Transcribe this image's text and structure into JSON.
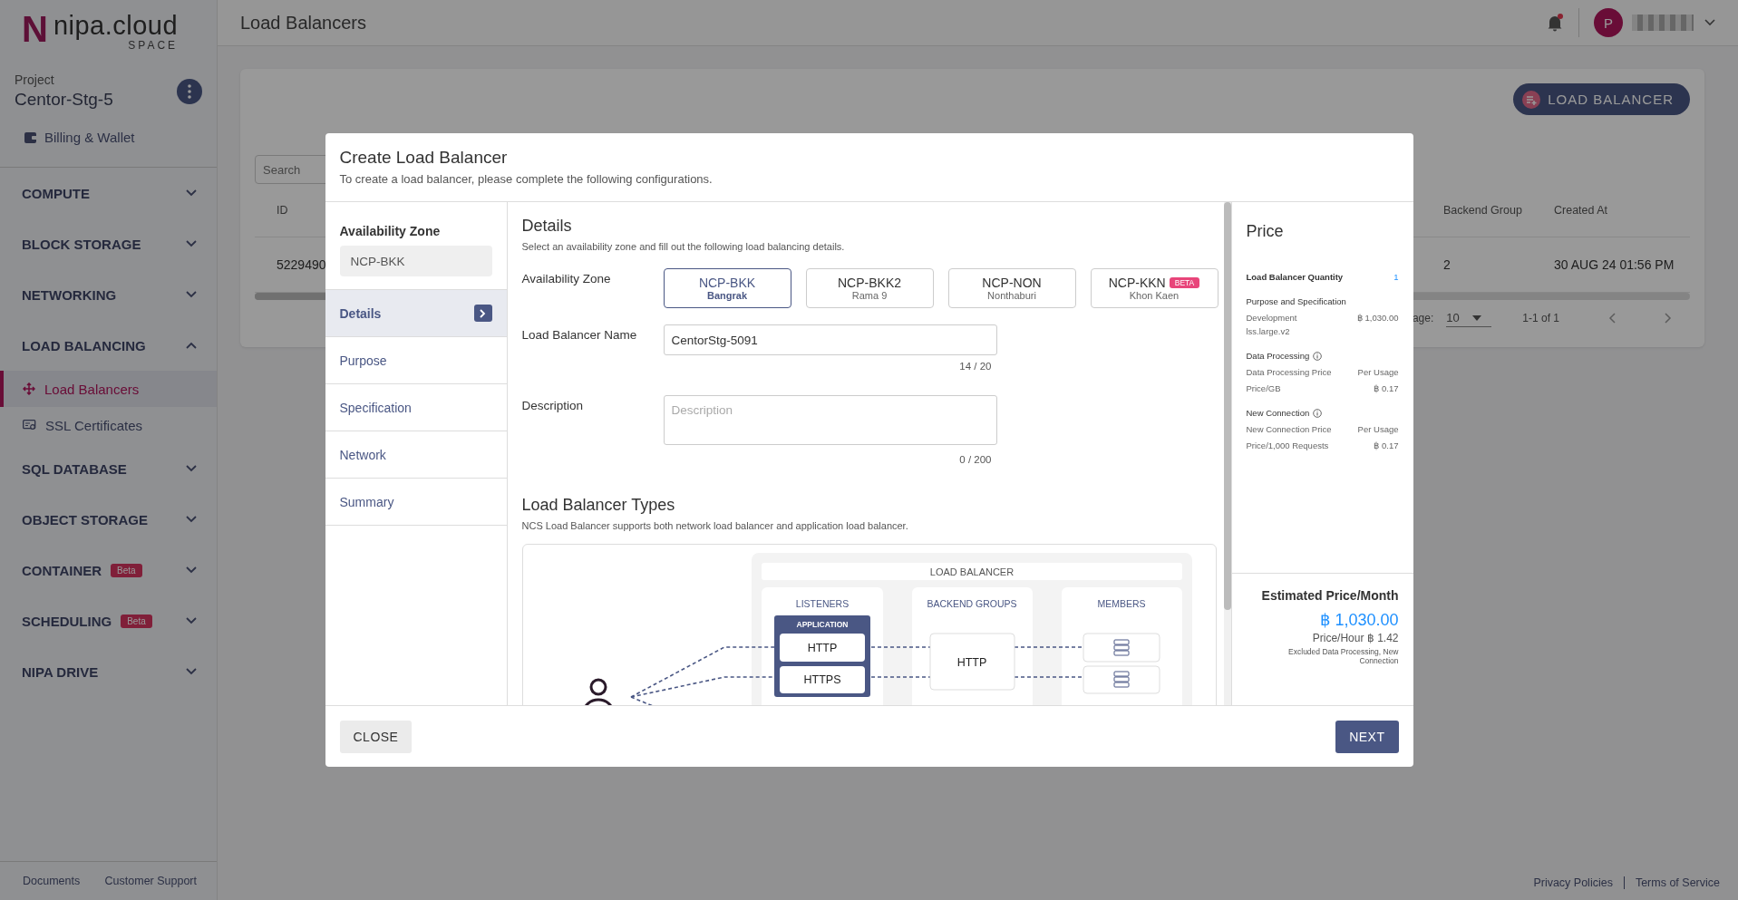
{
  "logo": {
    "mark": "N",
    "name": "nipa.cloud",
    "tagline": "SPACE"
  },
  "sidebar": {
    "project_label": "Project",
    "project_name": "Centor-Stg-5",
    "billing": "Billing & Wallet",
    "sections": [
      {
        "label": "COMPUTE",
        "expanded": false
      },
      {
        "label": "BLOCK STORAGE",
        "expanded": false
      },
      {
        "label": "NETWORKING",
        "expanded": false
      },
      {
        "label": "LOAD BALANCING",
        "expanded": true,
        "children": [
          {
            "label": "Load Balancers",
            "selected": true,
            "kind": "balancer"
          },
          {
            "label": "SSL Certificates",
            "selected": false,
            "kind": "certificate"
          }
        ]
      },
      {
        "label": "SQL DATABASE",
        "expanded": false
      },
      {
        "label": "OBJECT STORAGE",
        "expanded": false
      },
      {
        "label": "CONTAINER",
        "expanded": false,
        "badge": "Beta"
      },
      {
        "label": "SCHEDULING",
        "expanded": false,
        "badge": "Beta"
      },
      {
        "label": "NIPA DRIVE",
        "expanded": false
      }
    ],
    "footer_links": [
      "Documents",
      "Customer Support"
    ]
  },
  "header": {
    "title": "Load Balancers",
    "notification": true,
    "avatar_initial": "P"
  },
  "page": {
    "create_button": "LOAD BALANCER",
    "search": {
      "placeholder": "Search"
    },
    "table": {
      "columns": [
        "ID",
        "Backend Group",
        "Created At"
      ],
      "rows": [
        [
          "5229490",
          "2",
          "30 AUG 24 01:56 PM"
        ]
      ]
    },
    "pagination": {
      "rows_label": "age:",
      "rows_per_page": "10",
      "range": "1-1 of 1"
    },
    "footer_links": [
      "Privacy Policies",
      "Terms of Service"
    ]
  },
  "modal": {
    "title": "Create Load Balancer",
    "subtitle": "To create a load balancer, please complete the following configurations.",
    "zone_label": "Availability Zone",
    "zone_value": "NCP-BKK",
    "steps": [
      {
        "label": "Details",
        "selected": true
      },
      {
        "label": "Purpose",
        "selected": false
      },
      {
        "label": "Specification",
        "selected": false
      },
      {
        "label": "Network",
        "selected": false
      },
      {
        "label": "Summary",
        "selected": false
      }
    ],
    "details": {
      "title": "Details",
      "subtitle": "Select an availability zone and fill out the following load balancing details.",
      "zone_field_label": "Availability Zone",
      "zones": [
        {
          "code": "NCP-BKK",
          "location": "Bangrak",
          "selected": true
        },
        {
          "code": "NCP-BKK2",
          "location": "Rama 9",
          "selected": false
        },
        {
          "code": "NCP-NON",
          "location": "Nonthaburi",
          "selected": false
        },
        {
          "code": "NCP-KKN",
          "location": "Khon Kaen",
          "selected": false,
          "badge": "BETA"
        }
      ],
      "name_label": "Load Balancer Name",
      "name_value": "CentorStg-5091",
      "name_counter": "14 / 20",
      "description_label": "Description",
      "description_placeholder": "Description",
      "description_counter": "0 / 200"
    },
    "types": {
      "title": "Load Balancer Types",
      "subtitle": "NCS Load Balancer supports both network load balancer and application load balancer.",
      "diagram": {
        "title": "LOAD BALANCER",
        "columns": [
          "LISTENERS",
          "BACKEND GROUPS",
          "MEMBERS"
        ],
        "listener_group": "APPLICATION",
        "listeners": [
          "HTTP",
          "HTTPS"
        ],
        "backend_group": "HTTP"
      }
    },
    "price": {
      "title": "Price",
      "quantity_label": "Load Balancer Quantity",
      "quantity": "1",
      "sections": [
        {
          "title": "Purpose and Specification",
          "info": false,
          "rows": [
            {
              "label": "Development",
              "sublabel": "lss.large.v2",
              "value": "฿ 1,030.00"
            }
          ]
        },
        {
          "title": "Data Processing",
          "info": true,
          "rows": [
            {
              "label": "Data Processing Price",
              "value": "Per Usage"
            },
            {
              "label": "Price/GB",
              "value": "฿ 0.17"
            }
          ]
        },
        {
          "title": "New Connection",
          "info": true,
          "rows": [
            {
              "label": "New Connection Price",
              "value": "Per Usage"
            },
            {
              "label": "Price/1,000 Requests",
              "value": "฿ 0.17"
            }
          ]
        }
      ],
      "estimate_label": "Estimated Price/Month",
      "estimate": "฿ 1,030.00",
      "hourly": "Price/Hour ฿ 1.42",
      "note": "Excluded Data Processing, New Connection"
    },
    "buttons": {
      "close": "CLOSE",
      "next": "NEXT"
    }
  }
}
